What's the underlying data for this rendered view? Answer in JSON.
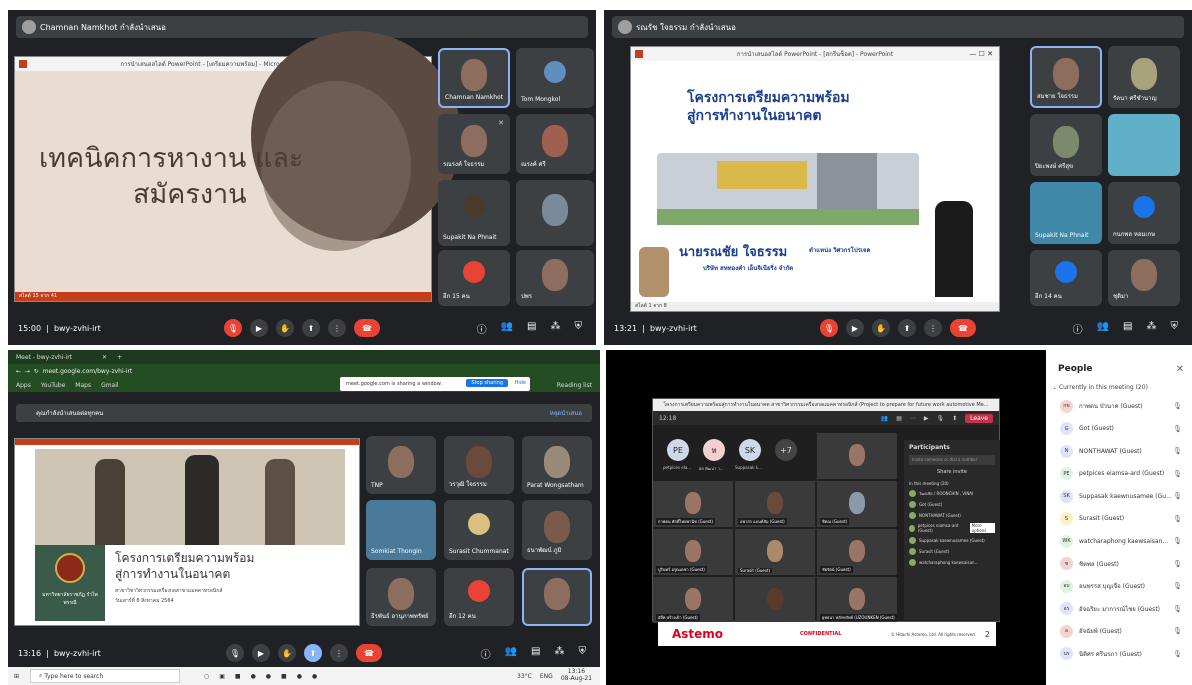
{
  "q1": {
    "presenter": "Chamnan Namkhot กำลังนำเสนอ",
    "ppt_title": "การนำเสนอสไลด์ PowerPoint - [เตรียมความพร้อม] - Microsoft PowerPoint",
    "slide_line1": "เทคนิคการหางาน และ",
    "slide_line2": "สมัครงาน",
    "slide_status": "สไลด์ 15 จาก 41",
    "tiles": [
      "Chamnan Namkhot",
      "Tom Mongkol",
      "รณรงค์ ใจธรรม",
      "ณรงค์ ศรี",
      "Supakit Na Phnait",
      "",
      "อีก 15 คน",
      "ปพร"
    ],
    "time": "15:00",
    "meet_code": "bwy-zvhi-irt"
  },
  "q2": {
    "presenter": "รณรัช ใจธรรม กำลังนำเสนอ",
    "ppt_title": "การนำเสนอสไลด์ PowerPoint - [สกรีนช็อต] - PowerPoint",
    "slide_title1": "โครงการเตรียมความพร้อม",
    "slide_title2": "สู่การทำงานในอนาคต",
    "speaker": "นายรณชัย ใจธรรม",
    "position": "ตำแหน่ง วิศวกรโปรเจค",
    "company": "บริษัท สหทองคำ เอ็นจิเนียริ่ง จำกัด",
    "slide_status": "สไลด์ 1 จาก 8",
    "tiles": [
      "สมชาย ใจธรรม",
      "รัตนา ศรีชำนาญ",
      "ปิยะพงษ์ ศรีสุข",
      "",
      "Supakit Na Phnait",
      "กนกพล หอมเกษ",
      "อีก 14 คน",
      "ชุติมา"
    ],
    "time": "13:21",
    "meet_code": "bwy-zvhi-irt"
  },
  "q3": {
    "tab": "Meet - bwy-zvhi-irt",
    "url": "meet.google.com/bwy-zvhi-irt",
    "bookmarks": [
      "Apps",
      "YouTube",
      "Maps",
      "Gmail"
    ],
    "reading_list": "Reading list",
    "share_text": "meet.google.com is sharing a window.",
    "stop_sharing": "Stop sharing",
    "hide": "Hide",
    "present_bar": "คุณกำลังนำเสนอต่อทุกคน",
    "stop_present": "หยุดนำเสนอ",
    "slide_title1": "โครงการเตรียมความพร้อม",
    "slide_title2": "สู่การทำงานในอนาคต",
    "slide_sub": "สาขาวิชาวิศวกรรมเครื่องกลสาขาแมคคาทรอนิกส์",
    "slide_date": "วันเสาร์ที่ 8 สิงหาคม 2564",
    "university": "มหาวิทยาลัยราชภัฏ รำไพพรรณี",
    "tiles": [
      "TNP",
      "วรวุฒิ ใจธรรม",
      "Parat Wongsatham",
      "Somkiat Thongin",
      "Surasit Chummanat",
      "ธนาพัฒน์ ภูมิ",
      "ธีรพันธ์ อานุภาพทรัพย์",
      "อีก 12 คน",
      ""
    ],
    "time": "13:16",
    "meet_code": "bwy-zvhi-irt",
    "taskbar_search": "Type here to search",
    "weather": "33°C",
    "lang": "ENG",
    "clock_time": "13:16",
    "clock_date": "08-Aug-21"
  },
  "q4": {
    "teams_title": "โครงการเตรียมความพร้อมสู่การทำงานในอนาคต สาขาวิศวกรรมเครื่องกลแมคคาทรอนิกส์ (Project to prepare for future work automotive Me...",
    "leave": "Leave",
    "call_time": "12:18",
    "top_avatars": [
      {
        "i": "PE",
        "n": "petpices ela..."
      },
      {
        "i": "ห",
        "n": "ยย พัฒนา ว..."
      },
      {
        "i": "SK",
        "n": "Suppasak k..."
      },
      {
        "i": "+7",
        "n": ""
      }
    ],
    "grid_names": [
      "กาพตน ศักดิ์ไทยพานิช (Guest)",
      "อพาสร แจนท์สัม (Guest)",
      "ชิตณ (Guest)",
      "บูรินทร์ อรุณเดชา (Guest)",
      "Surasit (Guest)",
      "ชัยรัตน์ (Guest)",
      "อัจ๊ท สร้างเป้า (Guest)",
      "",
      "ยุทธนา หลักทรัพย์ (UZOUNKEN (Guest)"
    ],
    "participants_title": "Participants",
    "search_ph": "Invite someone or dial a number",
    "share_invite": "Share invite",
    "in_meeting": "In this meeting (20)",
    "plist": [
      "วัฒนชัย / ROONCHIN , VINAI",
      "Got (Guest)",
      "NONTHAWAT (Guest)",
      "petpices eiamsa-ard (Guest)",
      "Suppasak kaewnusamee (Guest)",
      "Surasit (Guest)",
      "watcharaphong kaewsaisan..."
    ],
    "more_options": "More options",
    "astemo": "Astemo",
    "conference": "CONFIDENTIAL",
    "copyright": "© Hitachi Astemo, Ltd. All rights reserved.",
    "page": "2",
    "people_title": "People",
    "current": "Currently in this meeting (20)",
    "people": [
      {
        "i": "กข",
        "n": "กาพตน บัวนาค (Guest)",
        "c": "#f6d3d3"
      },
      {
        "i": "G",
        "n": "Got (Guest)",
        "c": "#dfe3f7"
      },
      {
        "i": "N",
        "n": "NONTHAWAT (Guest)",
        "c": "#dfe3f7"
      },
      {
        "i": "PE",
        "n": "petpices eiamsa-ard (Guest)",
        "c": "#dff3e0"
      },
      {
        "i": "SK",
        "n": "Suppasak kaewnusamee (Gu...",
        "c": "#dfe3f7"
      },
      {
        "i": "S",
        "n": "Surasit (Guest)",
        "c": "#fbf0c8"
      },
      {
        "i": "WK",
        "n": "watcharaphong kaewsaisan...",
        "c": "#dff3e0"
      },
      {
        "i": "ช",
        "n": "ชิตพล (Guest)",
        "c": "#f6d3d3"
      },
      {
        "i": "อบ",
        "n": "อนพรรส บุญเจือ (Guest)",
        "c": "#dff3e0"
      },
      {
        "i": "อร",
        "n": "อัจฉริยะ มาการณ์ไชย (Guest)",
        "c": "#dfe3f7"
      },
      {
        "i": "อ",
        "n": "อัจฉัยพ์ (Guest)",
        "c": "#f6d3d3"
      },
      {
        "i": "นร",
        "n": "นิติศร ศรีนรภา (Guest)",
        "c": "#dfe3f7"
      }
    ]
  }
}
